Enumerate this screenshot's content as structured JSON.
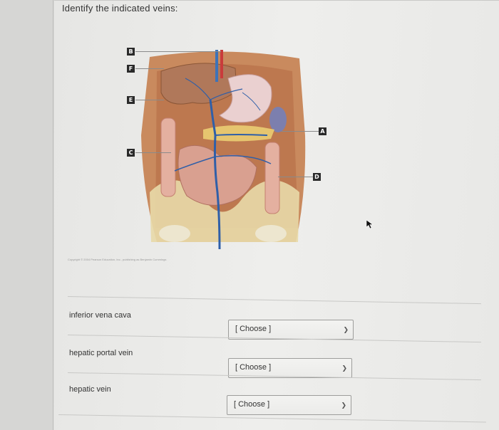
{
  "question": {
    "prompt": "Identify the indicated veins:"
  },
  "figure": {
    "labels": [
      "B",
      "F",
      "E",
      "C",
      "A",
      "D"
    ],
    "credit": "Copyright © 2004 Pearson Education, Inc., publishing as Benjamin Cummings"
  },
  "rows": [
    {
      "term": "inferior vena cava",
      "select": "[ Choose ]"
    },
    {
      "term": "hepatic portal vein",
      "select": "[ Choose ]"
    },
    {
      "term": "hepatic vein",
      "select": "[ Choose ]"
    }
  ],
  "icons": {
    "dropdown": "chevron-down-icon",
    "pointer": "mouse-cursor-icon"
  }
}
